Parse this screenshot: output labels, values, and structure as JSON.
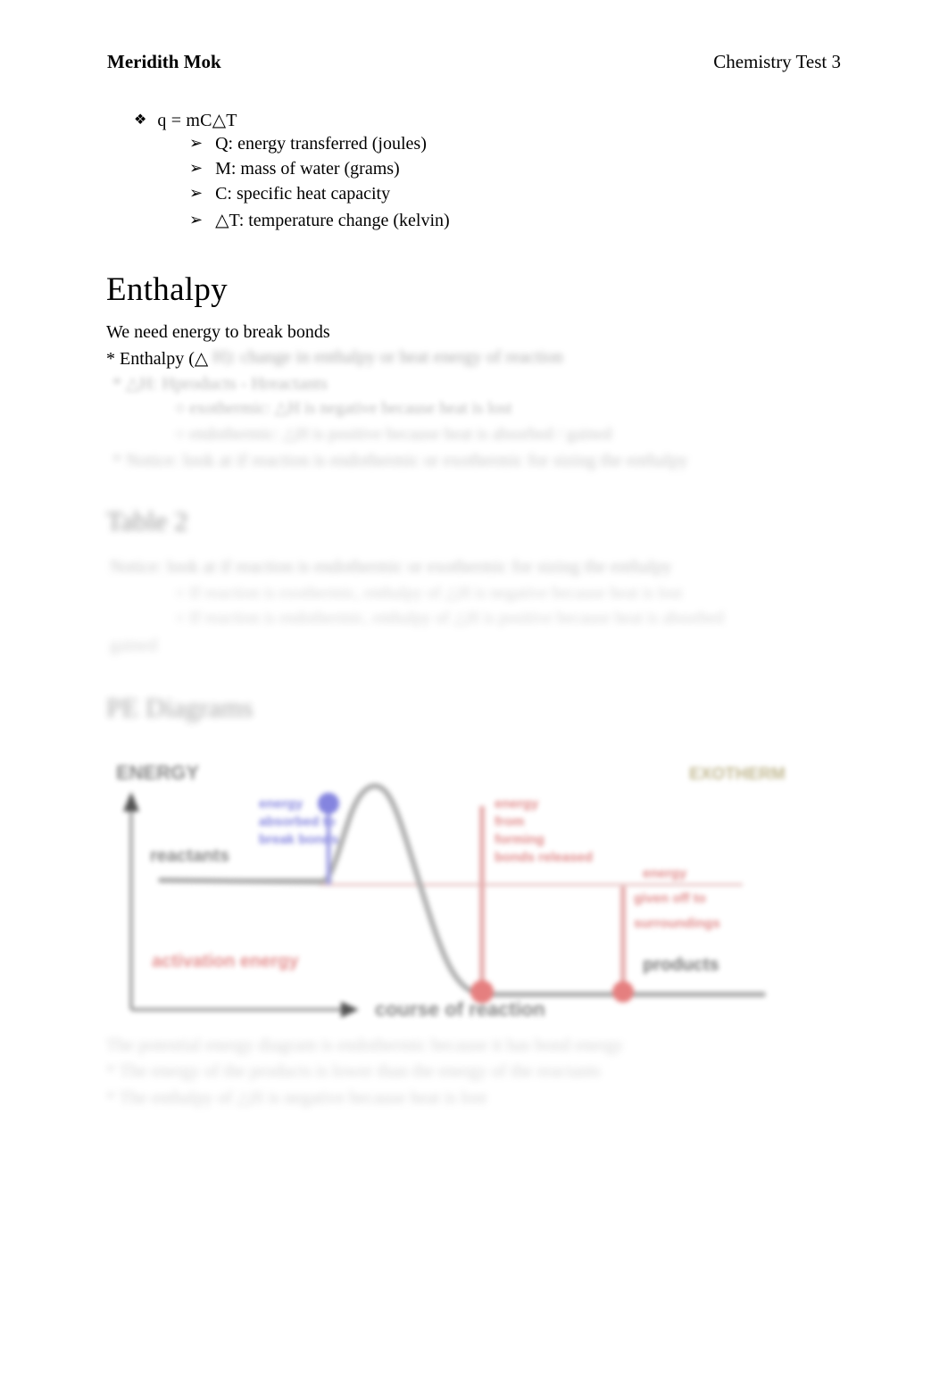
{
  "header": {
    "student_name": "Meridith Mok",
    "document_title": "Chemistry Test 3"
  },
  "formula_section": {
    "bullet_marker": "❖",
    "sub_marker": "➢",
    "formula": "q = mC△T",
    "definitions": [
      "Q: energy transferred (joules)",
      "M: mass of water (grams)",
      "C: specific heat capacity",
      "△T: temperature change (kelvin)"
    ]
  },
  "enthalpy_section": {
    "heading": "Enthalpy",
    "line_break_bonds": "We need energy to break bonds",
    "line_enthalpy_def": "* Enthalpy (△",
    "blurred_lines": [
      "H): change in enthalpy or heat energy of reaction",
      "* △H: Hproducts - Hreactants",
      "○ exothermic: △H is negative because heat is lost",
      "○ endothermic: △H is positive because heat is absorbed / gained",
      "* Notice: look at if reaction is endothermic or exothermic for sizing the enthalpy"
    ]
  },
  "table_section": {
    "heading": "Table 2",
    "blurred_lines": [
      "Notice: look at if reaction is endothermic or exothermic for sizing the enthalpy",
      "○ If reaction is exothermic, enthalpy of △H is negative because heat is lost",
      "○ If reaction is endothermic, enthalpy of △H is positive because heat is absorbed",
      "gained"
    ]
  },
  "pe_section": {
    "heading": "PE Diagrams",
    "blurred_lines": [
      "The potential energy diagram is endothermic because it has bond energy",
      "* The energy of the   products is lower than the energy of the reactants",
      "* The enthalpy of △H is negative because heat is lost"
    ]
  },
  "diagram": {
    "y_axis_label": "ENERGY",
    "x_axis_label": "course of reaction",
    "reactants_label": "reactants",
    "products_label": "products",
    "activation_energy_label": "activation energy",
    "blue_annotation": "energy absorbed to break bonds",
    "red_annotation_1": "energy from forming bonds released",
    "red_annotation_2": "energy given off to surroundings",
    "corner_label": "EXOTHERMIC",
    "colors": {
      "curve": "#9a9a9a",
      "axis": "#8a8a8a",
      "blue_text": "#5555cc",
      "red_text": "#cc4444",
      "gray_text": "#555555",
      "olive_text": "#b3a878"
    }
  },
  "page_colors": {
    "background": "#ffffff",
    "text": "#000000",
    "blurred_text": "#5b5b5b"
  }
}
